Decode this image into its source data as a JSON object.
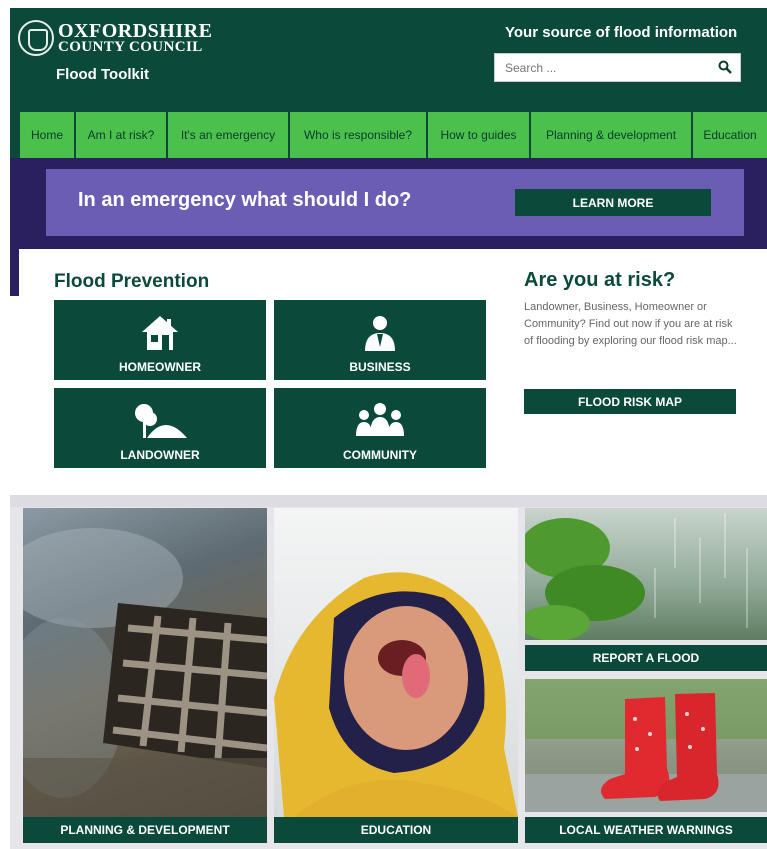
{
  "header": {
    "logo_line1": "OXFORDSHIRE",
    "logo_line2": "COUNTY COUNCIL",
    "subtitle": "Flood Toolkit",
    "tagline": "Your source of flood information",
    "search": {
      "placeholder": "Search ...",
      "icon": "search-icon"
    }
  },
  "nav": {
    "items": [
      {
        "label": "Home"
      },
      {
        "label": "Am I at risk?"
      },
      {
        "label": "It's an emergency"
      },
      {
        "label": "Who is responsible?"
      },
      {
        "label": "How to guides"
      },
      {
        "label": "Planning & development"
      },
      {
        "label": "Education"
      }
    ]
  },
  "banner": {
    "text": "In an emergency what should I do?",
    "button": "LEARN MORE"
  },
  "prevention": {
    "title": "Flood Prevention",
    "tiles": [
      {
        "label": "HOMEOWNER",
        "icon": "house-icon"
      },
      {
        "label": "BUSINESS",
        "icon": "business-person-icon"
      },
      {
        "label": "LANDOWNER",
        "icon": "tree-hill-icon"
      },
      {
        "label": "COMMUNITY",
        "icon": "group-icon"
      }
    ]
  },
  "risk": {
    "title": "Are you at risk?",
    "text": "Landowner, Business, Homeowner or Community? Find out now if you are at risk of flooding by exploring our flood risk map...",
    "button": "FLOOD RISK MAP"
  },
  "features": [
    {
      "label": "PLANNING & DEVELOPMENT"
    },
    {
      "label": "EDUCATION"
    },
    {
      "label": "REPORT A FLOOD"
    },
    {
      "label": "LOCAL WEATHER WARNINGS"
    }
  ],
  "colors": {
    "brand_dark_green": "#0b4a3b",
    "nav_green": "#4cc04c",
    "band_purple": "#2a2060",
    "banner_purple": "#6b5cb4"
  }
}
